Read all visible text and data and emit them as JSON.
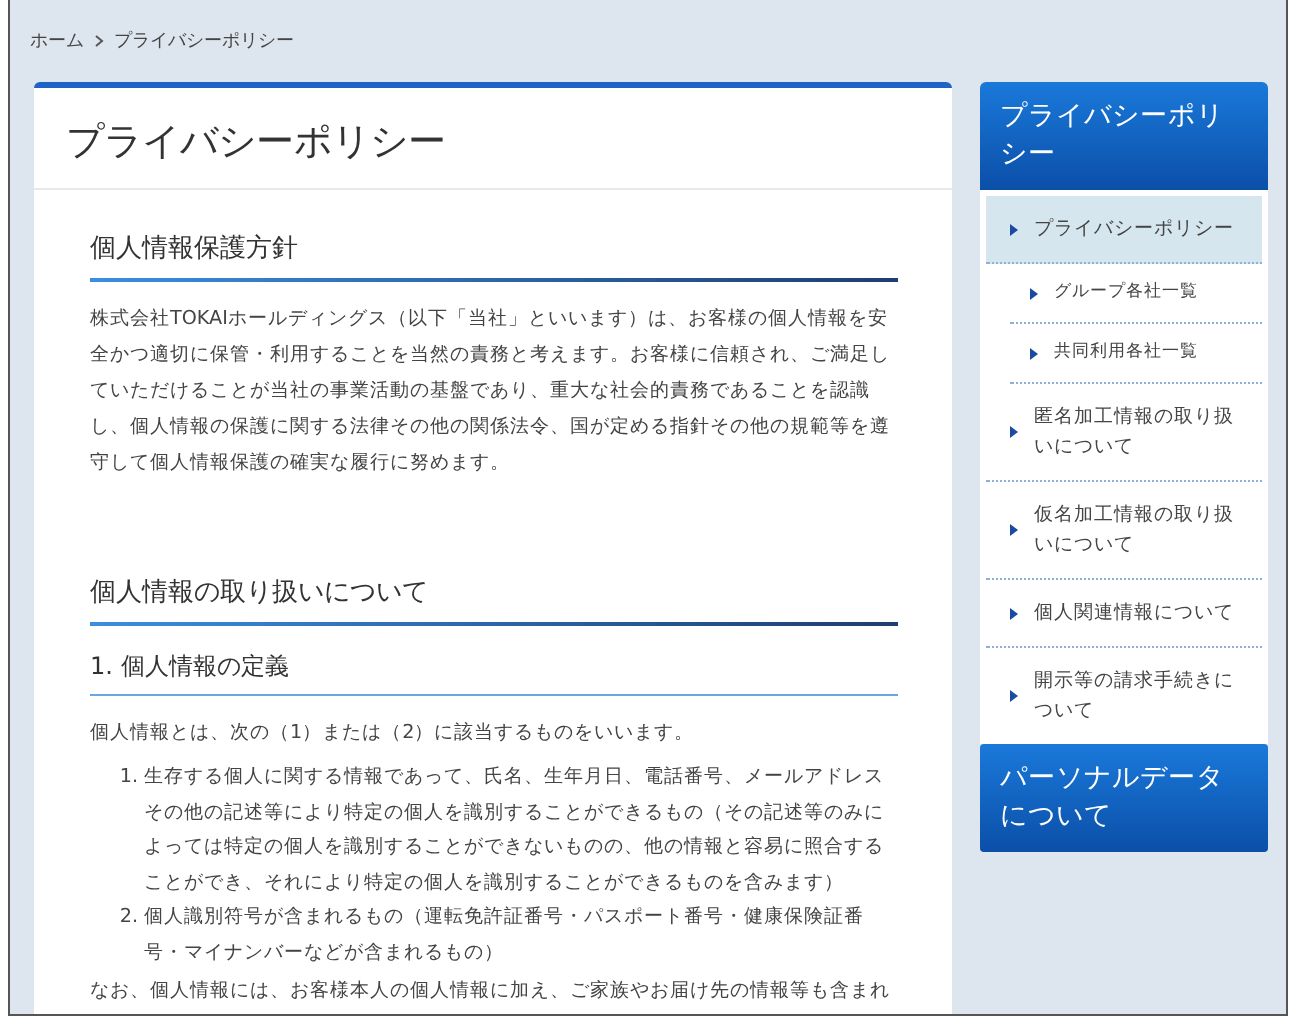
{
  "breadcrumb": [
    {
      "label": "ホーム"
    },
    {
      "label": "プライバシーポリシー"
    }
  ],
  "page_title": "プライバシーポリシー",
  "sections": [
    {
      "kind": "h2",
      "text": "個人情報保護方針"
    },
    {
      "kind": "p",
      "text": "株式会社TOKAIホールディングス（以下「当社」といいます）は、お客様の個人情報を安全かつ適切に保管・利用することを当然の責務と考えます。お客様に信頼され、ご満足していただけることが当社の事業活動の基盤であり、重大な社会的責務であることを認識し、個人情報の保護に関する法律その他の関係法令、国が定める指針その他の規範等を遵守して個人情報保護の確実な履行に努めます。"
    },
    {
      "kind": "h2",
      "text": "個人情報の取り扱いについて"
    },
    {
      "kind": "h3",
      "text": "1. 個人情報の定義"
    },
    {
      "kind": "p",
      "text": "個人情報とは、次の（1）または（2）に該当するものをいいます。"
    },
    {
      "kind": "ol",
      "items": [
        {
          "marker": "1.",
          "text": "生存する個人に関する情報であって、氏名、生年月日、電話番号、メールアドレスその他の記述等により特定の個人を識別することができるもの（その記述等のみによっては特定の個人を識別することができないものの、他の情報と容易に照合することができ、それにより特定の個人を識別することができるものを含みます）"
        },
        {
          "marker": "2.",
          "text": "個人識別符号が含まれるもの（運転免許証番号・パスポート番号・健康保険証番号・マイナンバーなどが含まれるもの）"
        }
      ]
    },
    {
      "kind": "cut",
      "text": "なお、個人情報には、お客様本人の個人情報に加え、ご家族やお届け先の情報等も含まれ"
    }
  ],
  "sidebar": [
    {
      "title": "プライバシーポリシー",
      "items": [
        {
          "label": "プライバシーポリシー",
          "selected": true,
          "children": [
            {
              "label": "グループ各社一覧",
              "selected": false
            },
            {
              "label": "共同利用各社一覧",
              "selected": false
            }
          ]
        },
        {
          "label": "匿名加工情報の取り扱いについて",
          "selected": false
        },
        {
          "label": "仮名加工情報の取り扱いについて",
          "selected": false
        },
        {
          "label": "個人関連情報について",
          "selected": false
        },
        {
          "label": "開示等の請求手続きについて",
          "selected": false
        }
      ]
    },
    {
      "title": "パーソナルデータについて"
    }
  ]
}
